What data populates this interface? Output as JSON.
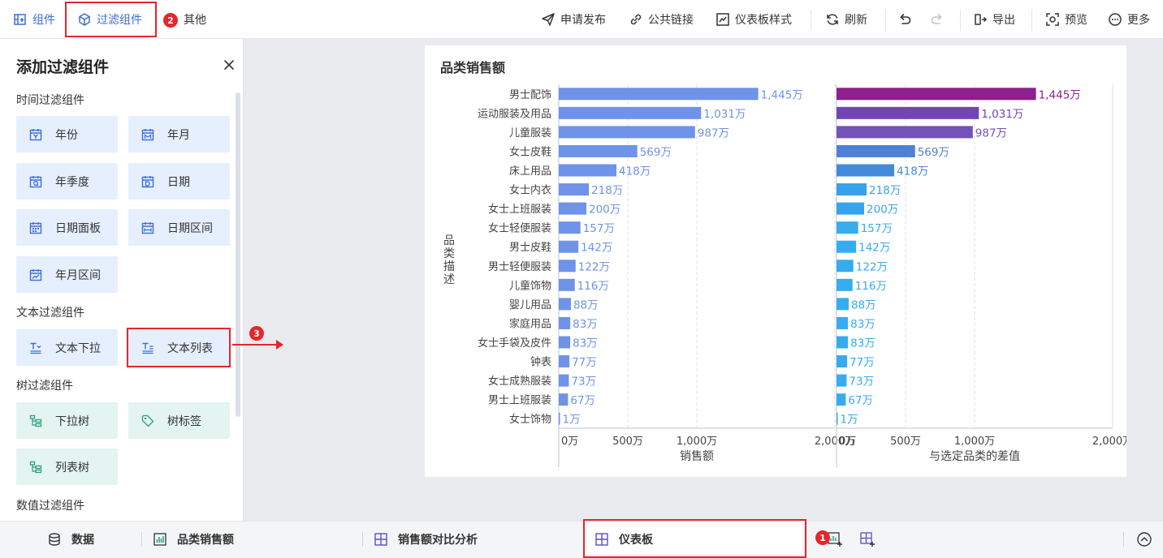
{
  "toolbar": {
    "components": "组件",
    "filter_components": "过滤组件",
    "others": "其他",
    "apply_publish": "申请发布",
    "public_link": "公共链接",
    "dashboard_style": "仪表板样式",
    "refresh": "刷新",
    "export": "导出",
    "preview": "预览",
    "more": "更多"
  },
  "badges": {
    "one": "1",
    "two": "2",
    "three": "3"
  },
  "panel": {
    "title": "添加过滤组件",
    "sections": {
      "time": {
        "title": "时间过滤组件",
        "items": [
          "年份",
          "年月",
          "年季度",
          "日期",
          "日期面板",
          "日期区间",
          "年月区间"
        ]
      },
      "text": {
        "title": "文本过滤组件",
        "items": [
          "文本下拉",
          "文本列表"
        ]
      },
      "tree": {
        "title": "树过滤组件",
        "items": [
          "下拉树",
          "树标签",
          "列表树"
        ]
      },
      "numeric": {
        "title": "数值过滤组件"
      }
    }
  },
  "chart_data": {
    "type": "bar",
    "orientation": "horizontal",
    "title": "品类销售额",
    "ylabel": "品类描述",
    "categories": [
      "男士配饰",
      "运动服装及用品",
      "儿童服装",
      "女士皮鞋",
      "床上用品",
      "女士内衣",
      "女士上班服装",
      "女士轻便服装",
      "男士皮鞋",
      "男士轻便服装",
      "儿童饰物",
      "婴儿用品",
      "家庭用品",
      "女士手袋及皮件",
      "钟表",
      "女士成熟服装",
      "男士上班服装",
      "女士饰物"
    ],
    "series": [
      {
        "name": "销售额",
        "values": [
          1445,
          1031,
          987,
          569,
          418,
          218,
          200,
          157,
          142,
          122,
          116,
          88,
          83,
          83,
          77,
          73,
          67,
          1
        ],
        "labels": [
          "1,445万",
          "1,031万",
          "987万",
          "569万",
          "418万",
          "218万",
          "200万",
          "157万",
          "142万",
          "122万",
          "116万",
          "88万",
          "83万",
          "83万",
          "77万",
          "73万",
          "67万",
          "1万"
        ],
        "color": "#6e93e8",
        "xlabel": "销售额"
      },
      {
        "name": "与选定品类的差值",
        "values": [
          1445,
          1031,
          987,
          569,
          418,
          218,
          200,
          157,
          142,
          122,
          116,
          88,
          83,
          83,
          77,
          73,
          67,
          1
        ],
        "labels": [
          "1,445万",
          "1,031万",
          "987万",
          "569万",
          "418万",
          "218万",
          "200万",
          "157万",
          "142万",
          "122万",
          "116万",
          "88万",
          "83万",
          "83万",
          "77万",
          "73万",
          "67万",
          "1万"
        ],
        "colors": [
          "#8e1f8c",
          "#7146b4",
          "#7452b8",
          "#4e80d6",
          "#4589da",
          "#35a2eb",
          "#35a4ec",
          "#36acef",
          "#36acef",
          "#36acef",
          "#36acef",
          "#36acef",
          "#36acef",
          "#36acef",
          "#36acef",
          "#36acef",
          "#36acef",
          "#36acef"
        ],
        "label_colors": [
          "#8e1f8c",
          "#7146b4",
          "#7452b8",
          "#4e80d6",
          "#4589da",
          "#35a2eb",
          "#35a4ec",
          "#36acef",
          "#36acef",
          "#36acef",
          "#36acef",
          "#36acef",
          "#36acef",
          "#36acef",
          "#36acef",
          "#36acef",
          "#36acef",
          "#36acef"
        ],
        "xlabel": "与选定品类的差值"
      }
    ],
    "xticks": [
      0,
      500,
      1000,
      2000
    ],
    "xtick_labels": [
      "0万",
      "500万",
      "1,000万",
      "2,000万"
    ],
    "xlim": [
      0,
      2000
    ],
    "grid": true
  },
  "bottombar": {
    "data": "数据",
    "category_sales": "品类销售额",
    "sales_comparison": "销售额对比分析",
    "dashboard": "仪表板"
  }
}
